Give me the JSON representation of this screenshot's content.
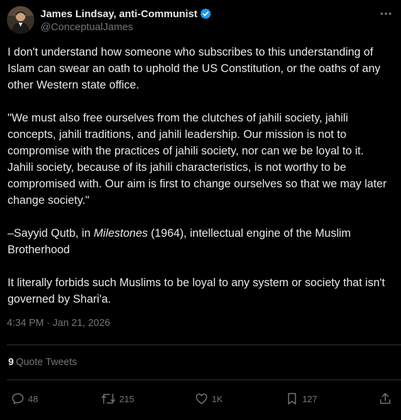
{
  "author": {
    "display_name": "James Lindsay, anti-Communist",
    "handle": "@ConceptualJames",
    "verified_icon": "verified-badge-icon",
    "avatar_icon": "avatar"
  },
  "tweet": {
    "paragraph_1": "I don't understand how someone who subscribes to this understanding of Islam can swear an oath to uphold the US Constitution, or the oaths of any other Western state office.",
    "paragraph_2": "\"We must also free ourselves from the clutches of jahili society, jahili concepts, jahili traditions, and jahili leadership. Our mission is not to compromise with the practices of jahili society, nor can we be loyal to it. Jahili society, because of its jahili characteristics, is not worthy to be compromised with. Our aim is first to change ourselves so that we may later change society.\"",
    "attribution_prefix": "–Sayyid Qutb, in ",
    "attribution_title": "Milestones",
    "attribution_suffix": " (1964), intellectual engine of the Muslim Brotherhood",
    "paragraph_4": "It literally forbids such Muslims to be loyal to any system or society that isn't governed by Shari'a.",
    "timestamp": "4:34 PM · Jan 21, 2026"
  },
  "quote_tweets": {
    "count": "9",
    "label": "Quote Tweets"
  },
  "actions": {
    "replies": "48",
    "retweets": "215",
    "likes": "1K",
    "bookmarks": "127"
  },
  "colors": {
    "background": "#000000",
    "text": "#e7e9ea",
    "secondary": "#71767b",
    "divider": "#2f3336",
    "verified": "#1d9bf0"
  }
}
